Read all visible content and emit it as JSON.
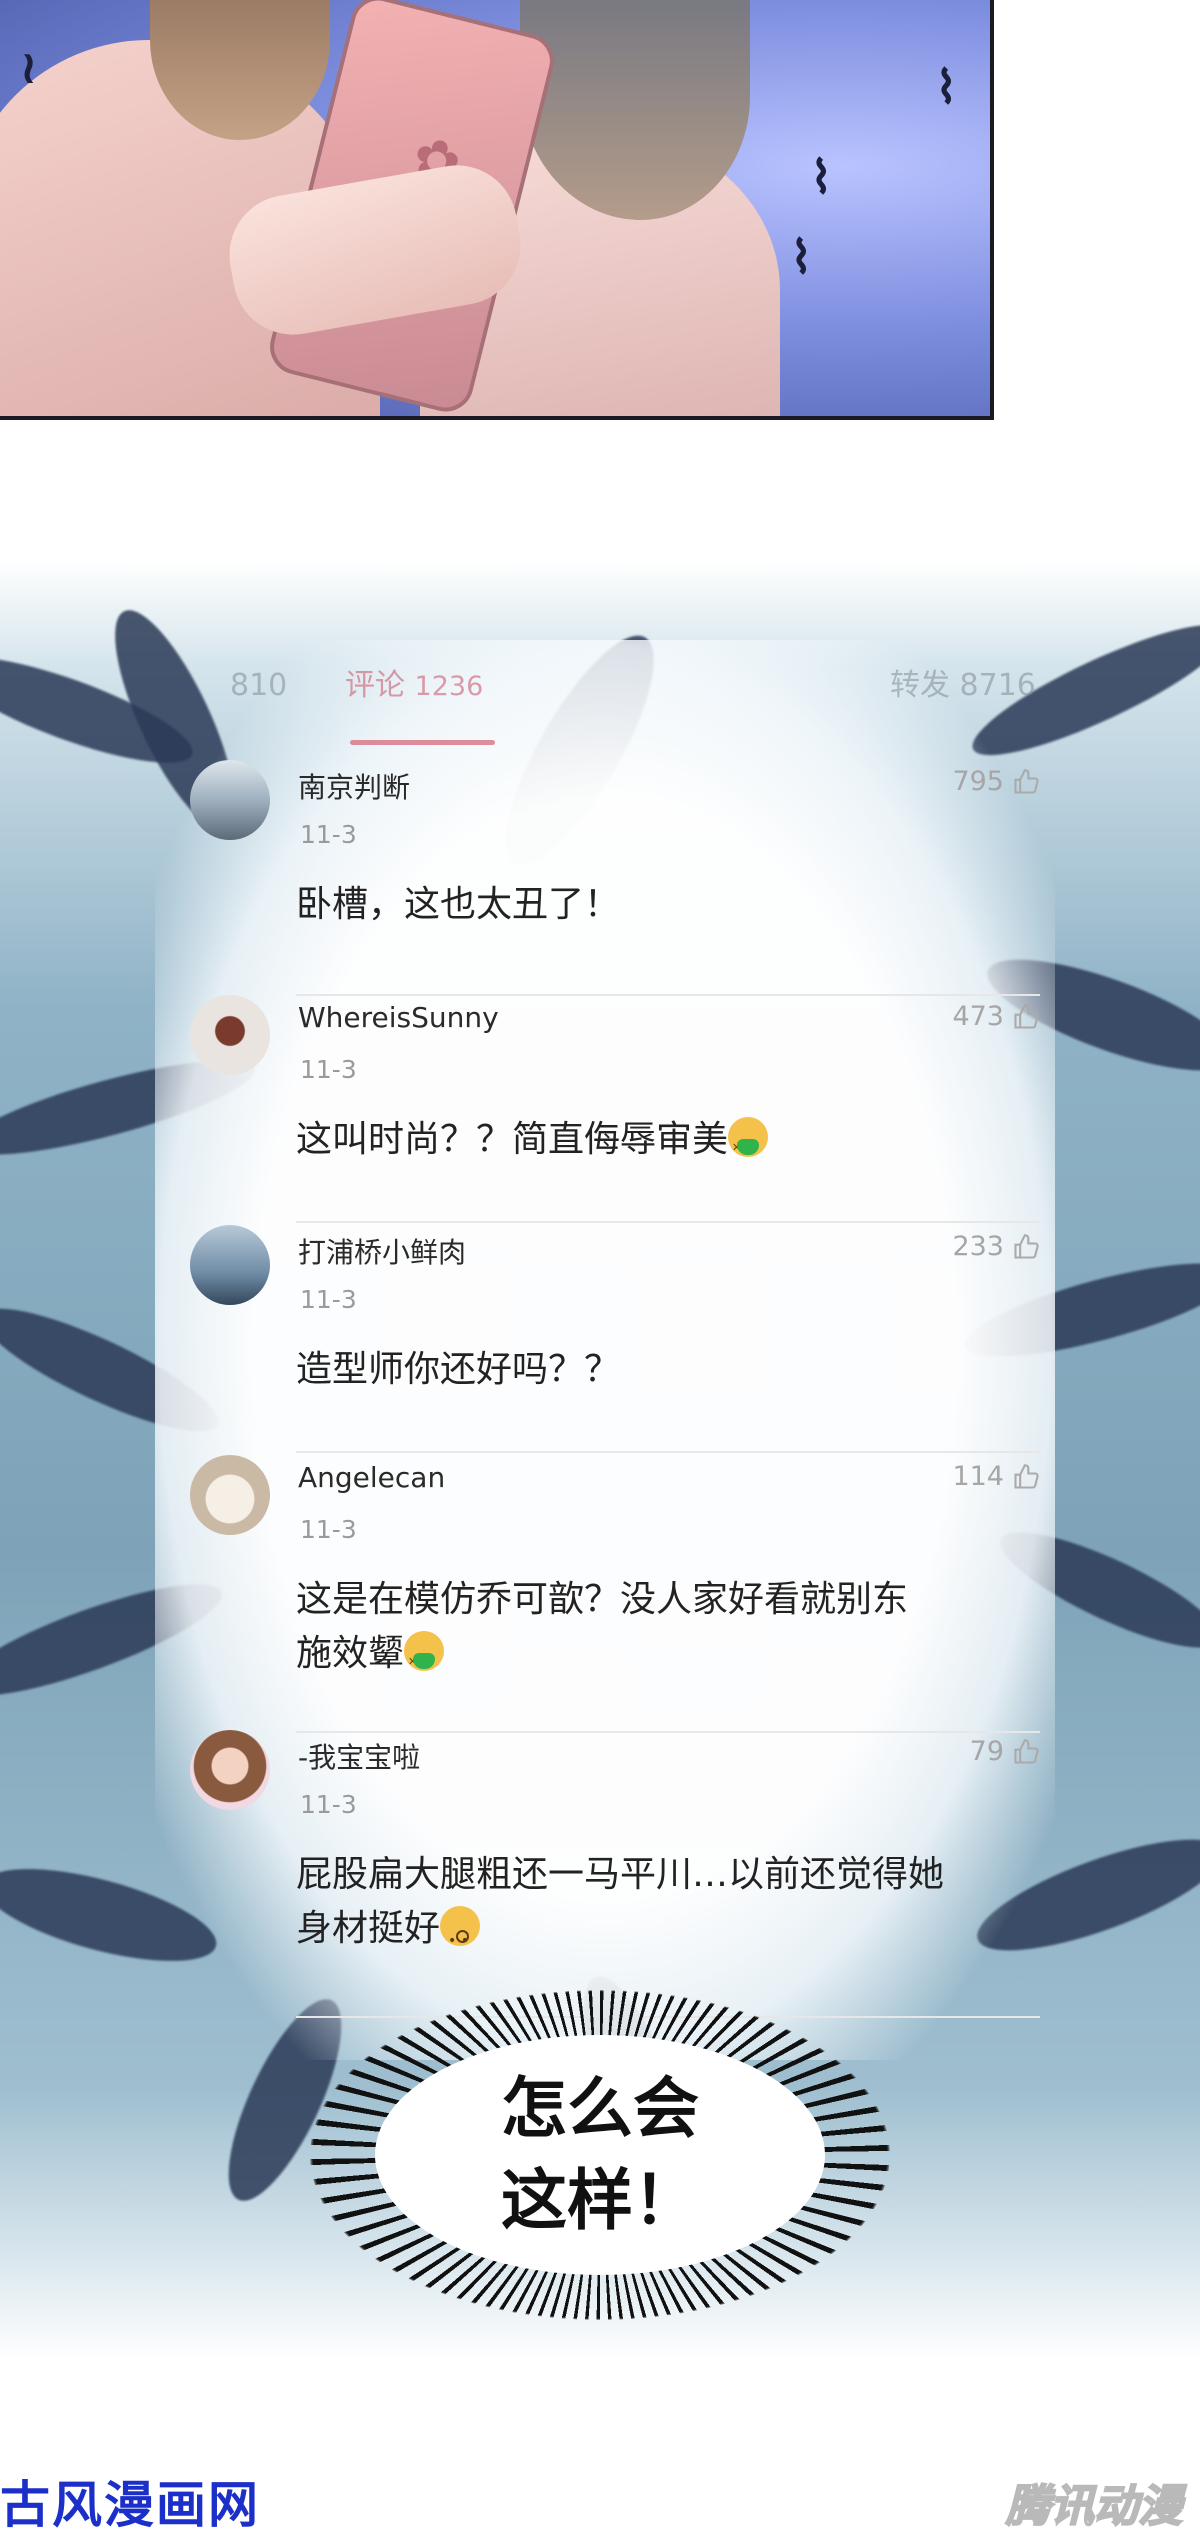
{
  "tabs": {
    "reposts_partial": "810",
    "comments_label": "评论",
    "comments_count": "1236",
    "forwards_label": "转发",
    "forwards_count": "8716"
  },
  "comments": [
    {
      "username": "南京判断",
      "date": "11-3",
      "likes": "795",
      "text": "卧槽，这也太丑了！",
      "emoji": ""
    },
    {
      "username": "WhereisSunny",
      "date": "11-3",
      "likes": "473",
      "text": "这叫时尚？？简直侮辱审美",
      "emoji": "nauseated-face-emoji"
    },
    {
      "username": "打浦桥小鲜肉",
      "date": "11-3",
      "likes": "233",
      "text": "造型师你还好吗？？",
      "emoji": ""
    },
    {
      "username": "Angelecan",
      "date": "11-3",
      "likes": "114",
      "text": "这是在模仿乔可歆？没人家好看就别东施效颦",
      "emoji": "nauseated-face-emoji"
    },
    {
      "username": "-我宝宝啦",
      "date": "11-3",
      "likes": "79",
      "text": "屁股扁大腿粗还一马平川…以前还觉得她身材挺好",
      "emoji": "hushed-face-emoji"
    }
  ],
  "speech_bubble": {
    "line1": "怎么会",
    "line2": "这样！"
  },
  "watermarks": {
    "left": "古风漫画网",
    "right": "腾讯动漫"
  },
  "colors": {
    "tab_active": "#d7687b",
    "watermark_left": "#1d2fc9",
    "tendril": "#2b3a57"
  }
}
